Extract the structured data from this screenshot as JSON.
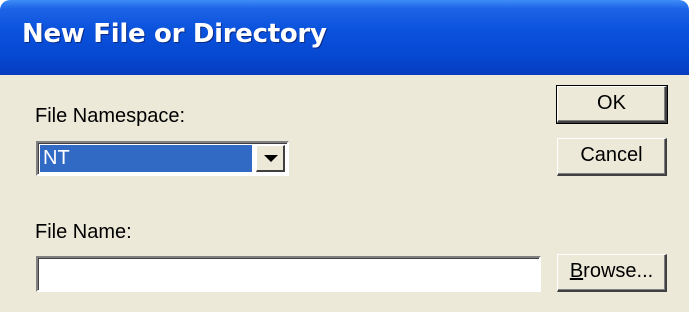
{
  "window": {
    "title": "New File or Directory"
  },
  "form": {
    "namespace_label": "File Namespace:",
    "namespace_value": "NT",
    "filename_label": "File Name:",
    "filename_value": "",
    "filename_placeholder": ""
  },
  "buttons": {
    "ok_label": "OK",
    "cancel_label": "Cancel",
    "browse_mnemonic": "B",
    "browse_rest": "rowse..."
  },
  "icons": {
    "dropdown": "chevron-down-icon"
  },
  "colors": {
    "titlebar": "#0a52dc",
    "dialog_face": "#ece9d8",
    "selection": "#316ac5"
  }
}
